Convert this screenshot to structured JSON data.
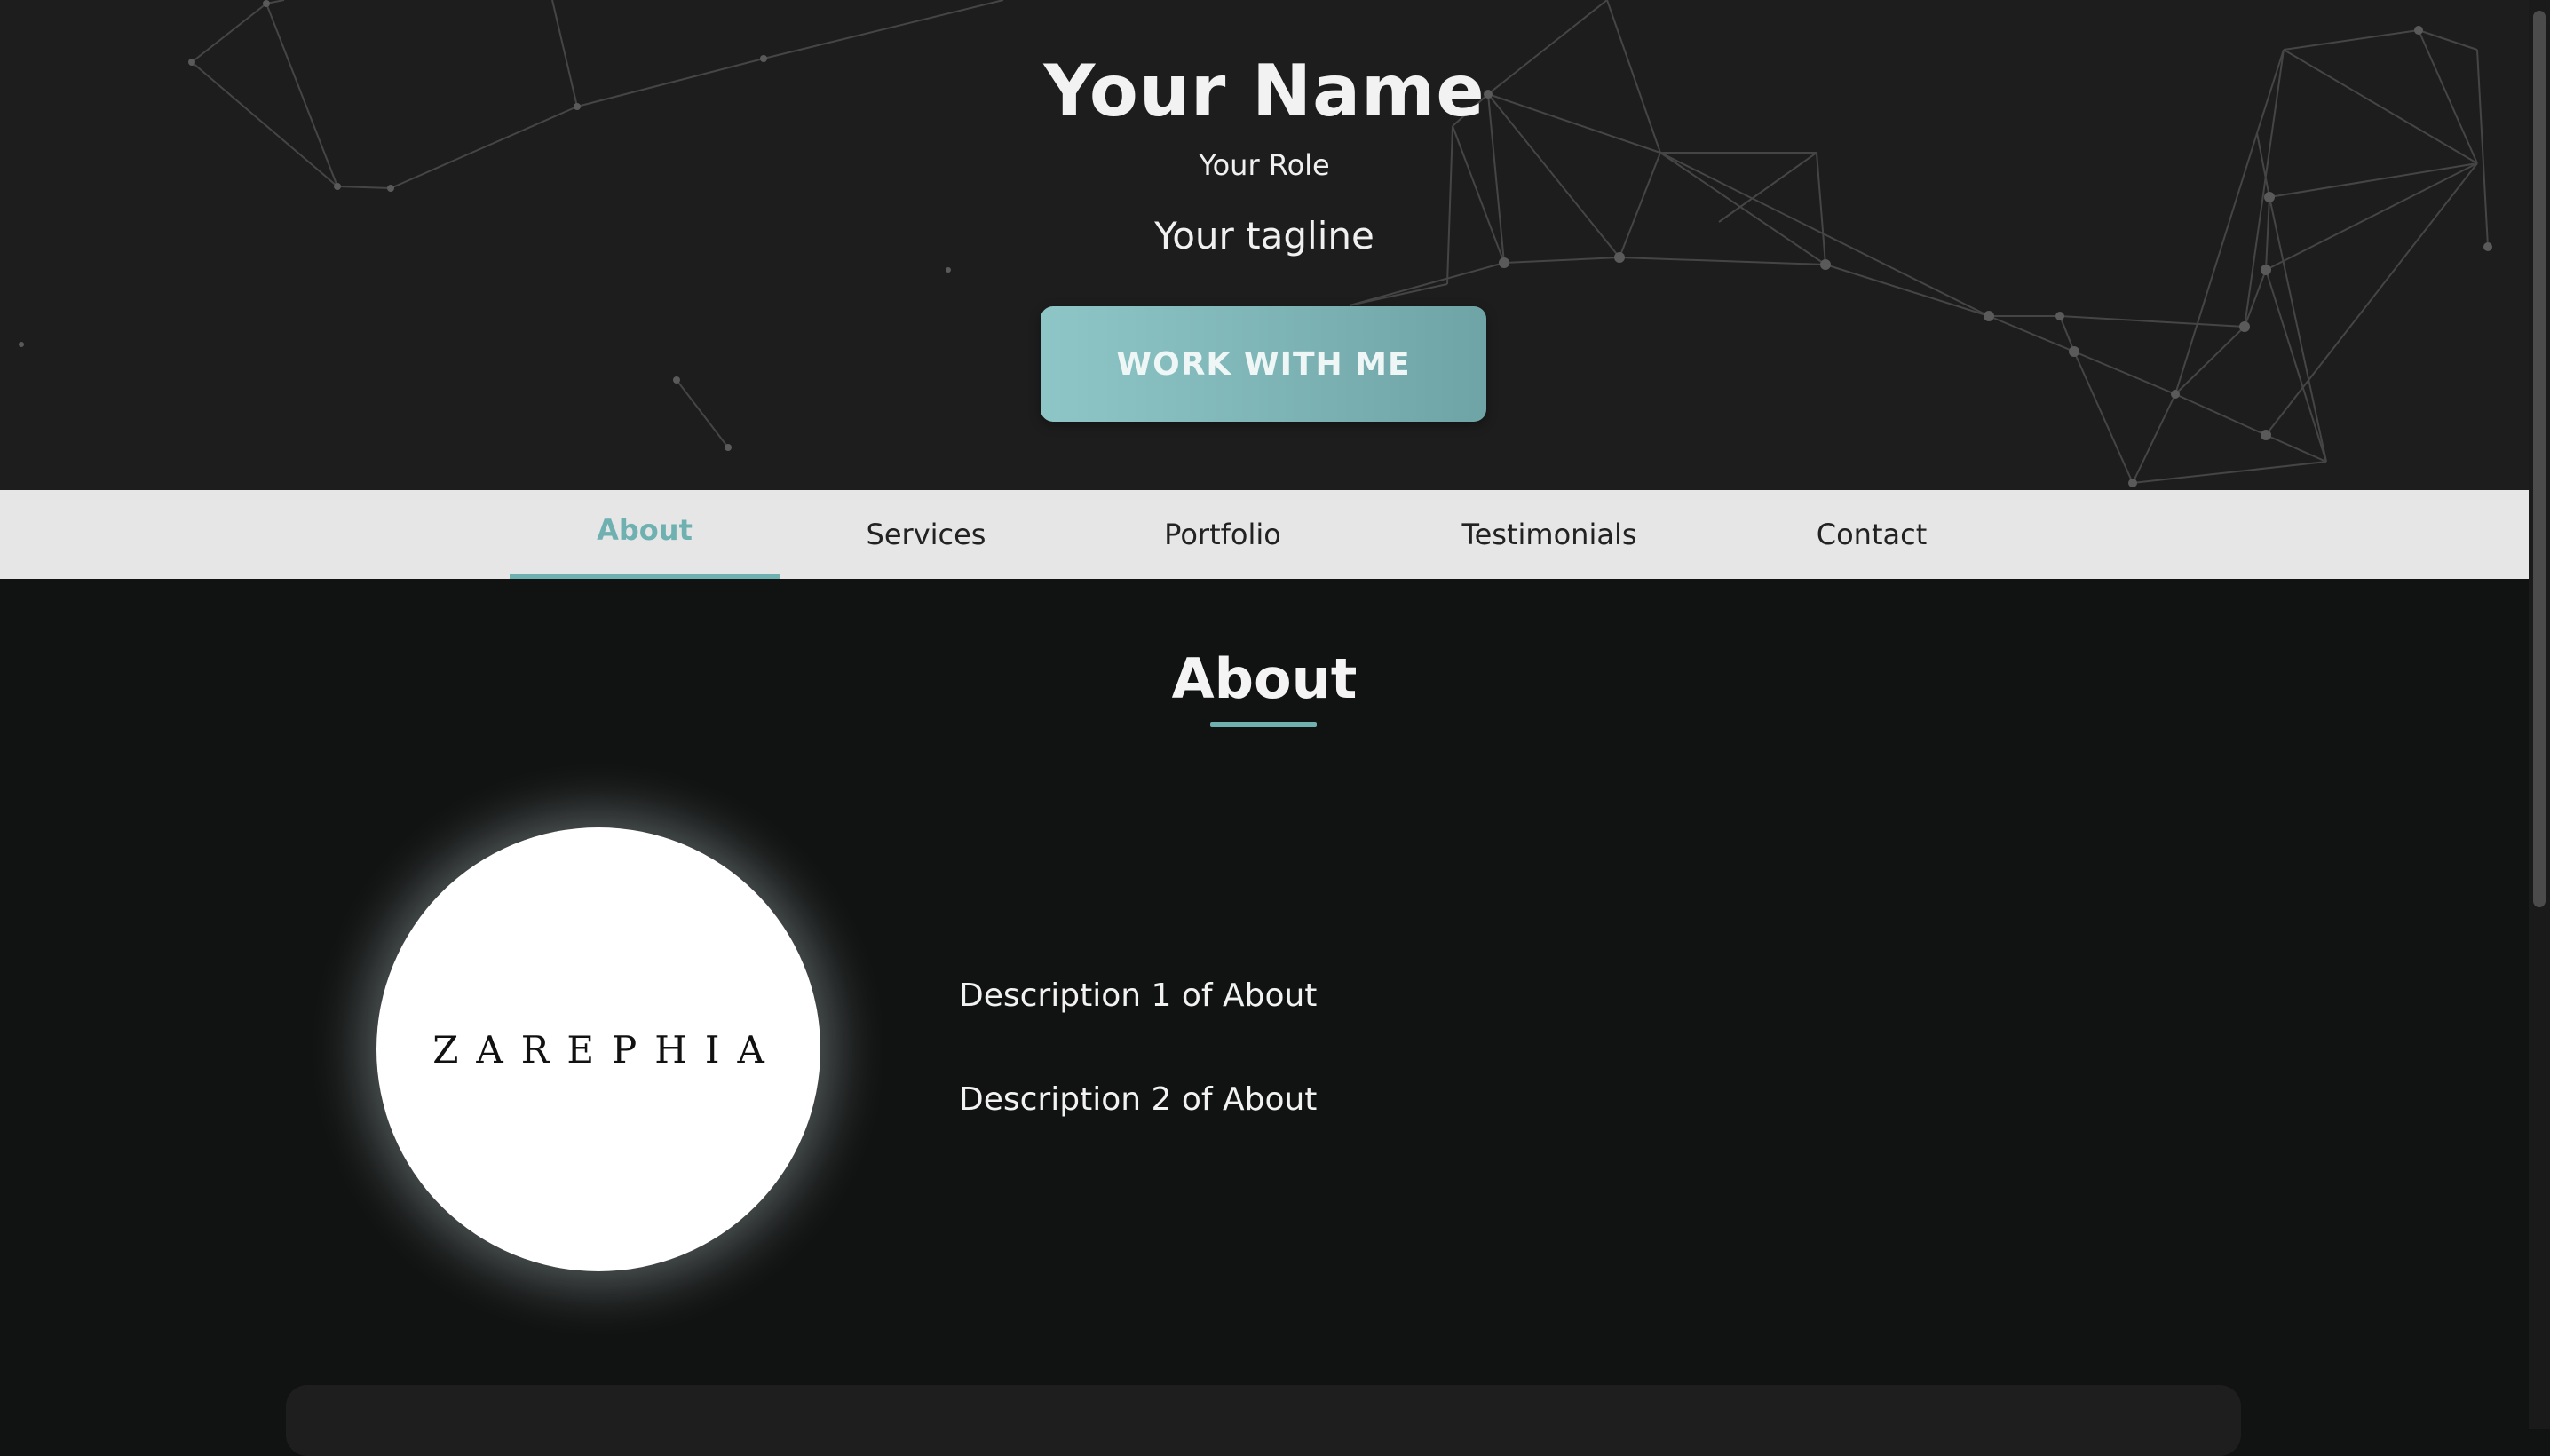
{
  "hero": {
    "name": "Your Name",
    "role": "Your Role",
    "tagline": "Your tagline",
    "cta_label": "WORK WITH ME"
  },
  "nav": {
    "items": [
      {
        "label": "About",
        "active": true
      },
      {
        "label": "Services",
        "active": false
      },
      {
        "label": "Portfolio",
        "active": false
      },
      {
        "label": "Testimonials",
        "active": false
      },
      {
        "label": "Contact",
        "active": false
      }
    ]
  },
  "about": {
    "title": "About",
    "logo_text": "ZAREPHIA",
    "descriptions": [
      "Description 1 of About",
      "Description 2 of About"
    ]
  },
  "colors": {
    "accent": "#6fb0b1",
    "hero_background": "#1d1d1e",
    "page_background": "#111212",
    "nav_background": "#e6e6e6"
  }
}
